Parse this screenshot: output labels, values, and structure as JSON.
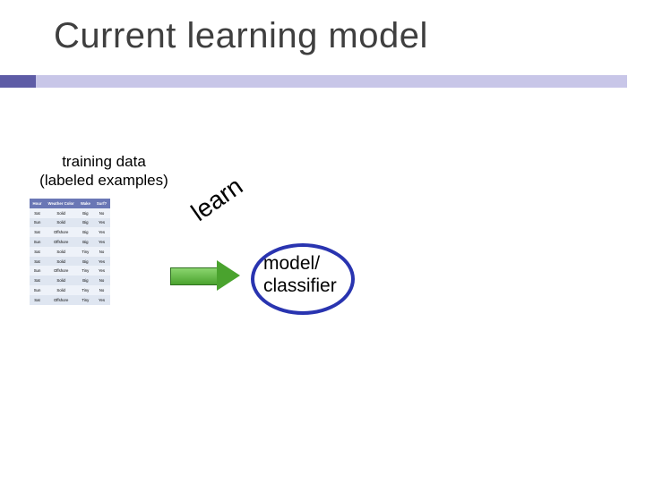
{
  "title": "Current learning model",
  "caption_line1": "training data",
  "caption_line2": "(labeled examples)",
  "learn_label": "learn",
  "model_line1": "model/",
  "model_line2": "classifier",
  "table": {
    "headers": [
      "Hour",
      "Weather Color",
      "Wake",
      "Surf?"
    ],
    "rows": [
      [
        "Sat",
        "Solid",
        "Big",
        "No"
      ],
      [
        "Sun",
        "Solid",
        "Big",
        "Yes"
      ],
      [
        "Sat",
        "Offshore",
        "Big",
        "Yes"
      ],
      [
        "Sun",
        "Offshore",
        "Big",
        "Yes"
      ],
      [
        "Sat",
        "Solid",
        "Tiny",
        "No"
      ],
      [
        "Sat",
        "Solid",
        "Big",
        "Yes"
      ],
      [
        "Sun",
        "Offshore",
        "Tiny",
        "Yes"
      ],
      [
        "Sat",
        "Solid",
        "Big",
        "No"
      ],
      [
        "Sun",
        "Solid",
        "Tiny",
        "No"
      ],
      [
        "Sat",
        "Offshore",
        "Tiny",
        "Yes"
      ]
    ]
  }
}
